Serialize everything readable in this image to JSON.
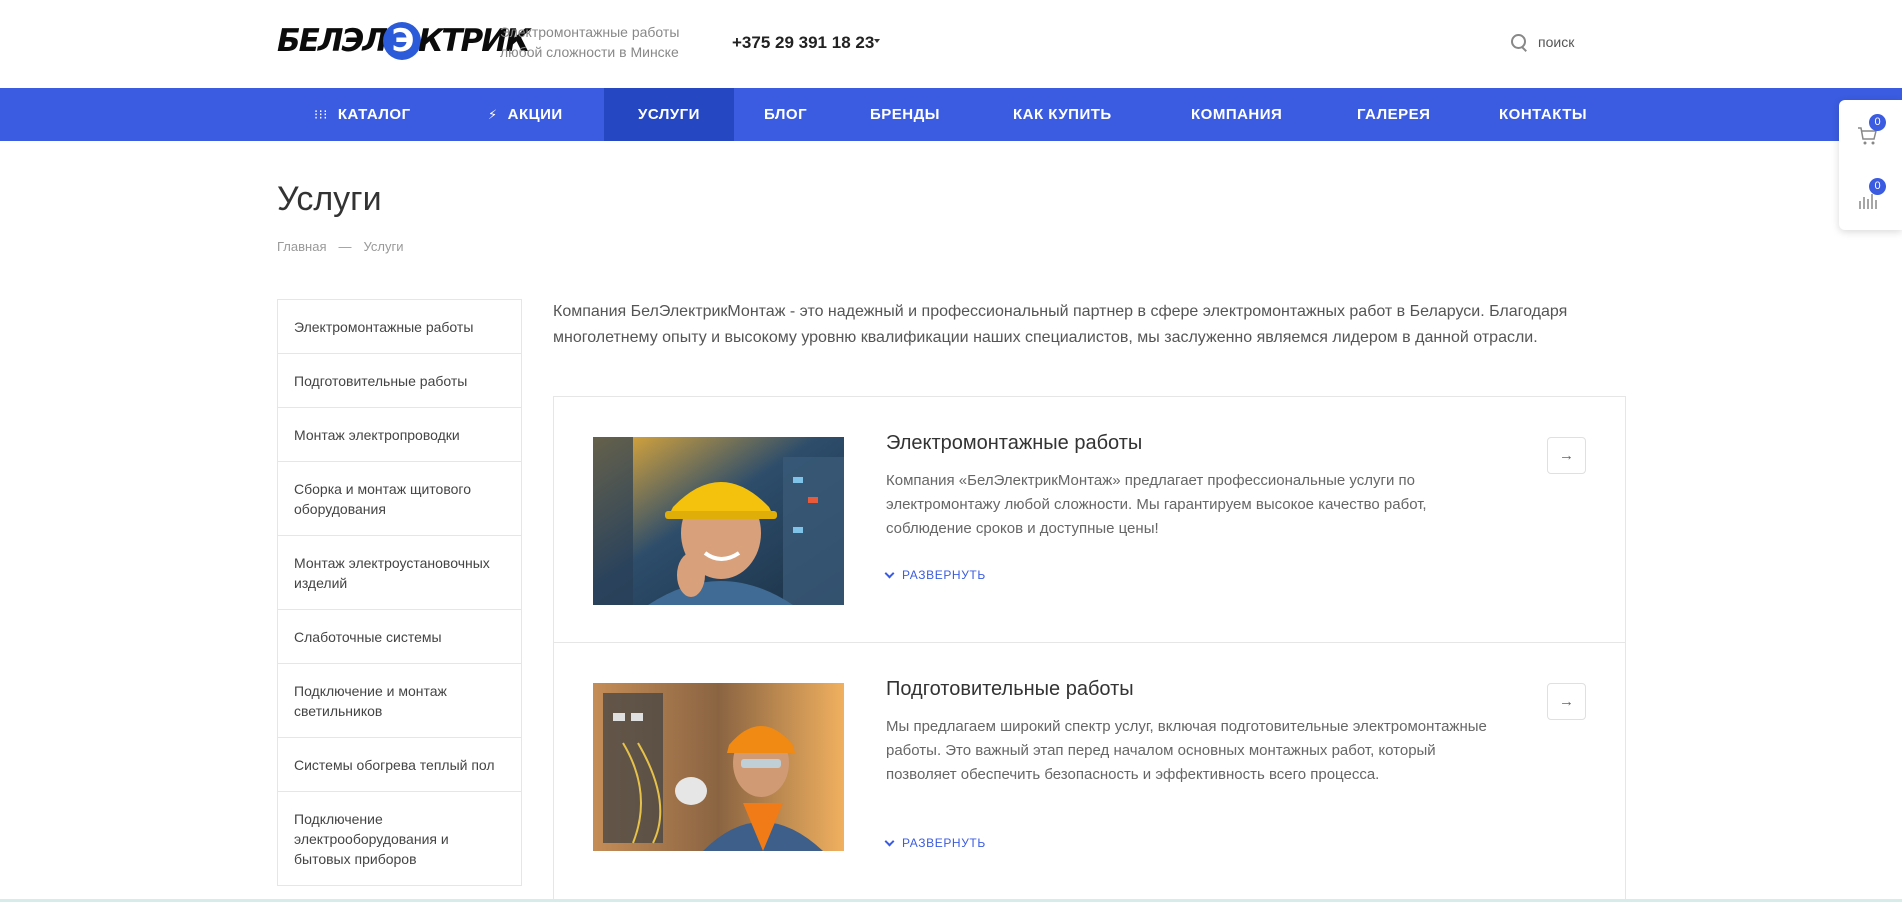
{
  "header": {
    "logo_left": "БЕЛЭЛ",
    "logo_mark": "Э",
    "logo_right": "КТРИК",
    "tagline": "Электромонтажные работы любой сложности в Минске",
    "phone": "+375 29 391 18 23",
    "search_label": "поиск"
  },
  "nav": {
    "items": [
      {
        "label": "КАТАЛОГ",
        "icon": "grid-icon"
      },
      {
        "label": "АКЦИИ",
        "icon": "bolt-icon"
      },
      {
        "label": "УСЛУГИ"
      },
      {
        "label": "БЛОГ"
      },
      {
        "label": "БРЕНДЫ"
      },
      {
        "label": "КАК КУПИТЬ"
      },
      {
        "label": "КОМПАНИЯ"
      },
      {
        "label": "ГАЛЕРЕЯ"
      },
      {
        "label": "КОНТАКТЫ"
      }
    ],
    "active": "УСЛУГИ"
  },
  "float_panel": {
    "cart_count": "0",
    "compare_count": "0"
  },
  "page": {
    "title": "Услуги",
    "breadcrumb": [
      "Главная",
      "—",
      "Услуги"
    ]
  },
  "sidebar": {
    "items": [
      "Электромонтажные работы",
      "Подготовительные работы",
      "Монтаж электропроводки",
      "Сборка и монтаж щитового оборудования",
      "Монтаж электроустановочных изделий",
      "Слаботочные системы",
      "Подключение и монтаж светильников",
      "Системы обогрева теплый пол",
      "Подключение электрооборудования и бытовых приборов"
    ]
  },
  "main": {
    "intro": "Компания БелЭлектрикМонтаж - это надежный и профессиональный партнер в сфере электромонтажных работ в Беларуси. Благодаря многолетнему опыту и высокому уровню квалификации наших специалистов, мы заслуженно являемся лидером в данной отрасли.",
    "cards": [
      {
        "title": "Электромонтажные работы",
        "desc": "Компания «БелЭлектрикМонтаж» предлагает профессиональные услуги по электромонтажу любой сложности. Мы гарантируем высокое качество работ, соблюдение сроков и доступные цены!",
        "expand": "РАЗВЕРНУТЬ",
        "arrow": "→"
      },
      {
        "title": "Подготовительные работы",
        "desc": "Мы предлагаем широкий спектр услуг, включая подготовительные электромонтажные работы. Это важный этап перед началом основных монтажных работ, который позволяет обеспечить безопасность и эффективность всего процесса.",
        "expand": "РАЗВЕРНУТЬ",
        "arrow": "→"
      }
    ]
  },
  "colors": {
    "accent": "#3b5ce0",
    "nav_active": "#2647c2",
    "text": "#333333",
    "muted": "#999999"
  }
}
